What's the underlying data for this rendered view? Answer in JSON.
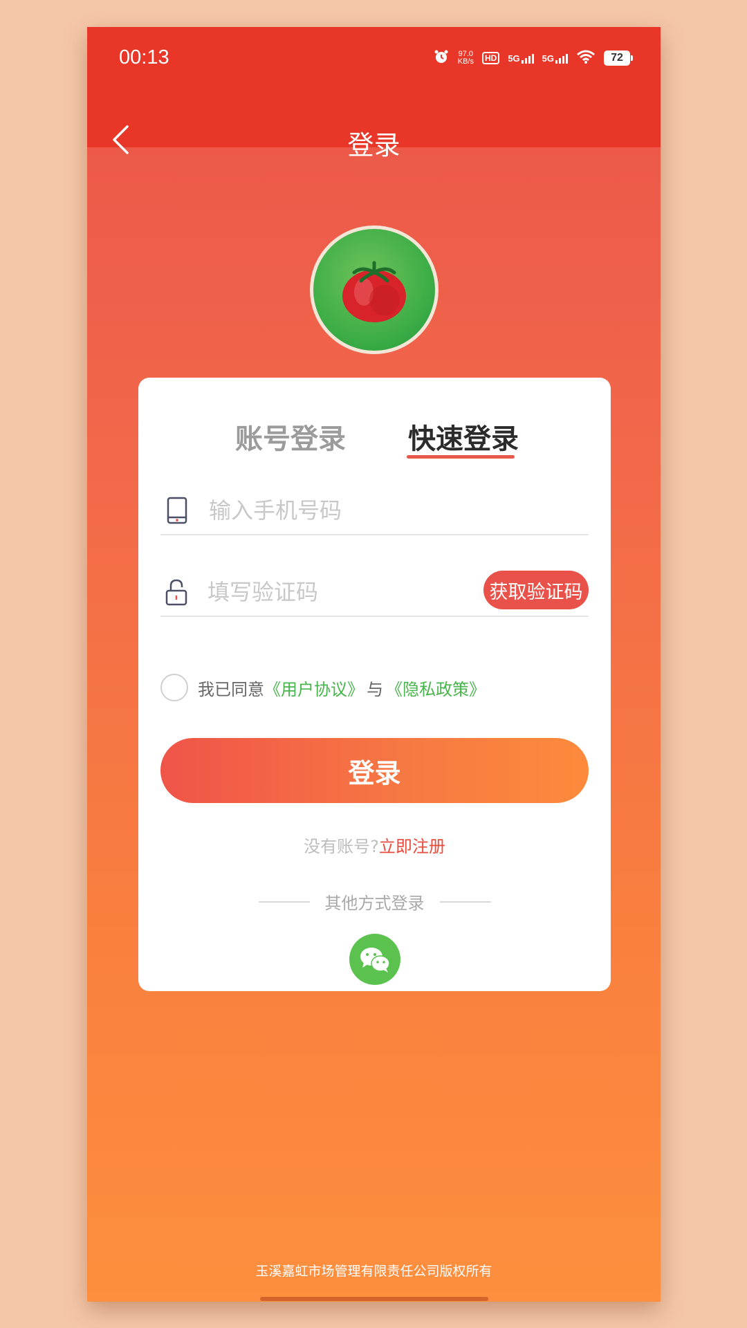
{
  "status_bar": {
    "time": "00:13",
    "network_speed_value": "97.0",
    "network_speed_unit": "KB/s",
    "hd_label": "HD",
    "signal_1": "5G",
    "signal_2": "5G",
    "battery": "72",
    "icons": [
      "alarm-icon",
      "wifi-icon",
      "battery-icon"
    ]
  },
  "nav": {
    "title": "登录",
    "back_icon": "chevron-left-icon"
  },
  "logo": {
    "icon": "tomato-icon"
  },
  "tabs": [
    {
      "label": "账号登录",
      "active": false
    },
    {
      "label": "快速登录",
      "active": true
    }
  ],
  "form": {
    "phone_placeholder": "输入手机号码",
    "phone_value": "",
    "code_placeholder": "填写验证码",
    "code_value": "",
    "get_code_label": "获取验证码",
    "agree_prefix": "我已同意",
    "user_agreement": "《用户协议》",
    "agree_and": "与",
    "privacy_policy": "《隐私政策》",
    "agreed": false,
    "login_label": "登录"
  },
  "register": {
    "prompt": "没有账号?",
    "link": "立即注册"
  },
  "other_login": {
    "label": "其他方式登录",
    "methods": [
      "wechat-icon"
    ]
  },
  "footer": {
    "copyright": "玉溪嘉虹市场管理有限责任公司版权所有"
  },
  "colors": {
    "topbar": "#e83628",
    "accent": "#e8524a",
    "link_green": "#48b54c",
    "wechat_green": "#5cc24f"
  }
}
